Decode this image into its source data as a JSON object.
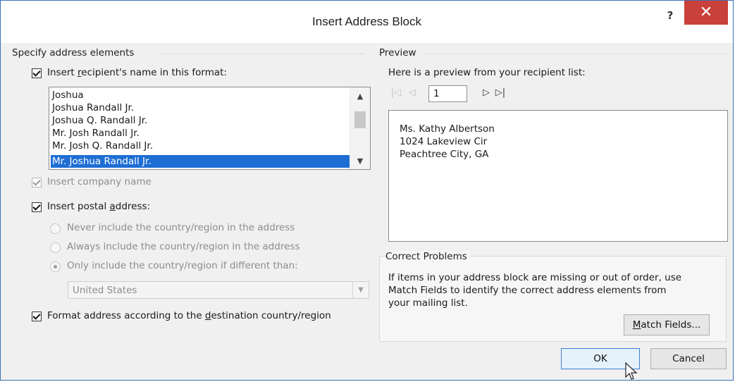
{
  "window": {
    "title": "Insert Address Block",
    "help_label": "?",
    "close_label": "✕"
  },
  "left": {
    "group_label": "Specify address elements",
    "name_format": {
      "label_pre": "Insert ",
      "label_accel": "r",
      "label_post": "ecipient's name in this format:",
      "checked": true,
      "options": [
        "Joshua",
        "Joshua Randall Jr.",
        "Joshua Q. Randall Jr.",
        "Mr. Josh Randall Jr.",
        "Mr. Josh Q. Randall Jr.",
        "Mr. Joshua Randall Jr."
      ],
      "selected": "Mr. Joshua Randall Jr."
    },
    "company": {
      "label": "Insert company name",
      "checked": true,
      "enabled": false
    },
    "postal": {
      "label_pre": "Insert postal ",
      "label_accel": "a",
      "label_post": "ddress:",
      "checked": true,
      "radio_never": "Never include the country/region in the address",
      "radio_always": "Always include the country/region in the address",
      "radio_only": "Only include the country/region if different than:",
      "selected_radio": "only",
      "country": "United States"
    },
    "format_dest": {
      "label_pre": "Format address according to the ",
      "label_accel": "d",
      "label_post": "estination country/region",
      "checked": true
    }
  },
  "preview": {
    "group_label": "Preview",
    "intro": "Here is a preview from your recipient list:",
    "record": "1",
    "lines": [
      "Ms. Kathy Albertson",
      "1024 Lakeview Cir",
      "Peachtree City, GA"
    ]
  },
  "correct": {
    "group_label": "Correct Problems",
    "text_lines": [
      "If items in your address block are missing or out of order, use",
      "Match Fields to identify the correct address elements from",
      "your mailing list."
    ],
    "match_accel": "M",
    "match_rest": "atch Fields..."
  },
  "buttons": {
    "ok": "OK",
    "cancel": "Cancel"
  },
  "colors": {
    "selection": "#1e6ed4",
    "close_red": "#c9413a"
  }
}
